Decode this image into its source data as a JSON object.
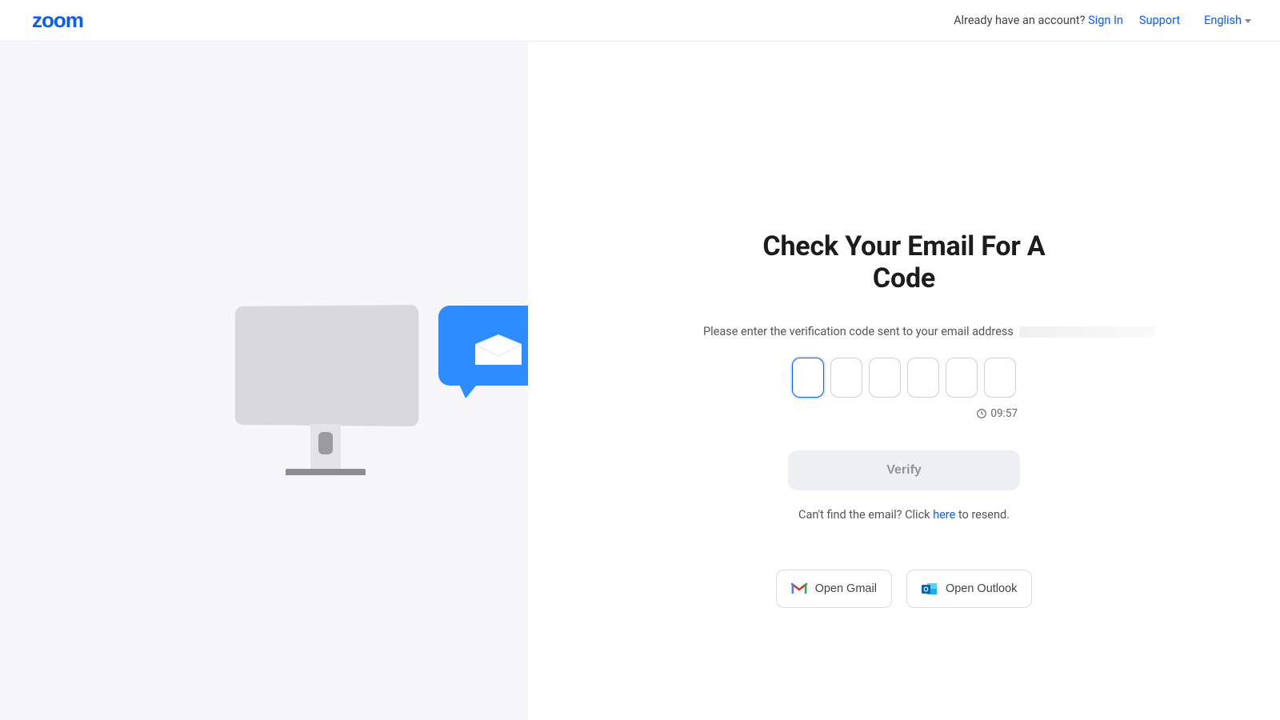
{
  "header": {
    "logo": "zoom",
    "account_prompt": "Already have an account?",
    "signin": "Sign In",
    "support": "Support",
    "language": "English"
  },
  "card": {
    "title": "Check Your Email For A Code",
    "instruction": "Please enter the verification code sent to your email address",
    "timer": "09:57",
    "verify": "Verify",
    "resend_prefix": "Can't find the email? Click ",
    "resend_link": "here",
    "resend_suffix": " to resend.",
    "open_gmail": "Open Gmail",
    "open_outlook": "Open Outlook"
  },
  "code_digits": 6
}
